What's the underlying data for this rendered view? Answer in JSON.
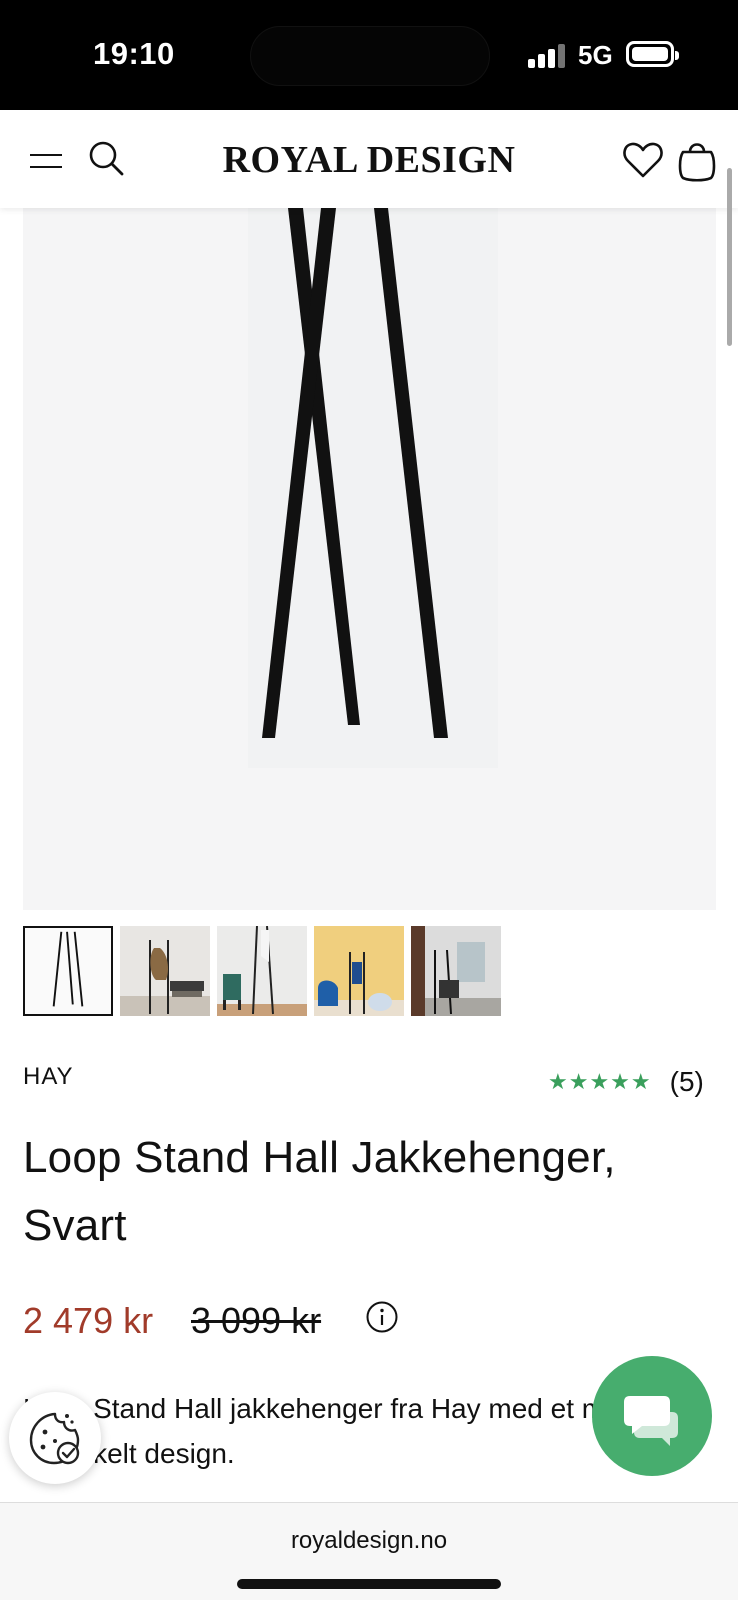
{
  "status_bar": {
    "time": "19:10",
    "network": "5G"
  },
  "header": {
    "logo": "ROYAL DESIGN",
    "icons": [
      "menu-icon",
      "search-icon",
      "heart-icon",
      "shopping-bag-icon"
    ]
  },
  "gallery": {
    "background_color": "#f5f5f6",
    "thumbnails": [
      {
        "name": "thumb-product-only",
        "active": true
      },
      {
        "name": "thumb-hallway-coats",
        "active": false
      },
      {
        "name": "thumb-green-chair",
        "active": false
      },
      {
        "name": "thumb-yellow-room",
        "active": false
      },
      {
        "name": "thumb-living-room",
        "active": false
      }
    ]
  },
  "product": {
    "brand": "HAY",
    "stars": "★★★★★",
    "review_count": "(5)",
    "title": "Loop Stand Hall Jakkehenger, Svart",
    "sale_price": "2 479 kr",
    "old_price": "3 099 kr",
    "description": "Loop Stand Hall jakkehenger fra Hay med et moderne og enkelt design."
  },
  "colors": {
    "sale_price": "#a13b2a",
    "rating_green": "#3a9f5c",
    "chat_green": "#47ad6e"
  },
  "browser": {
    "url": "royaldesign.no"
  }
}
